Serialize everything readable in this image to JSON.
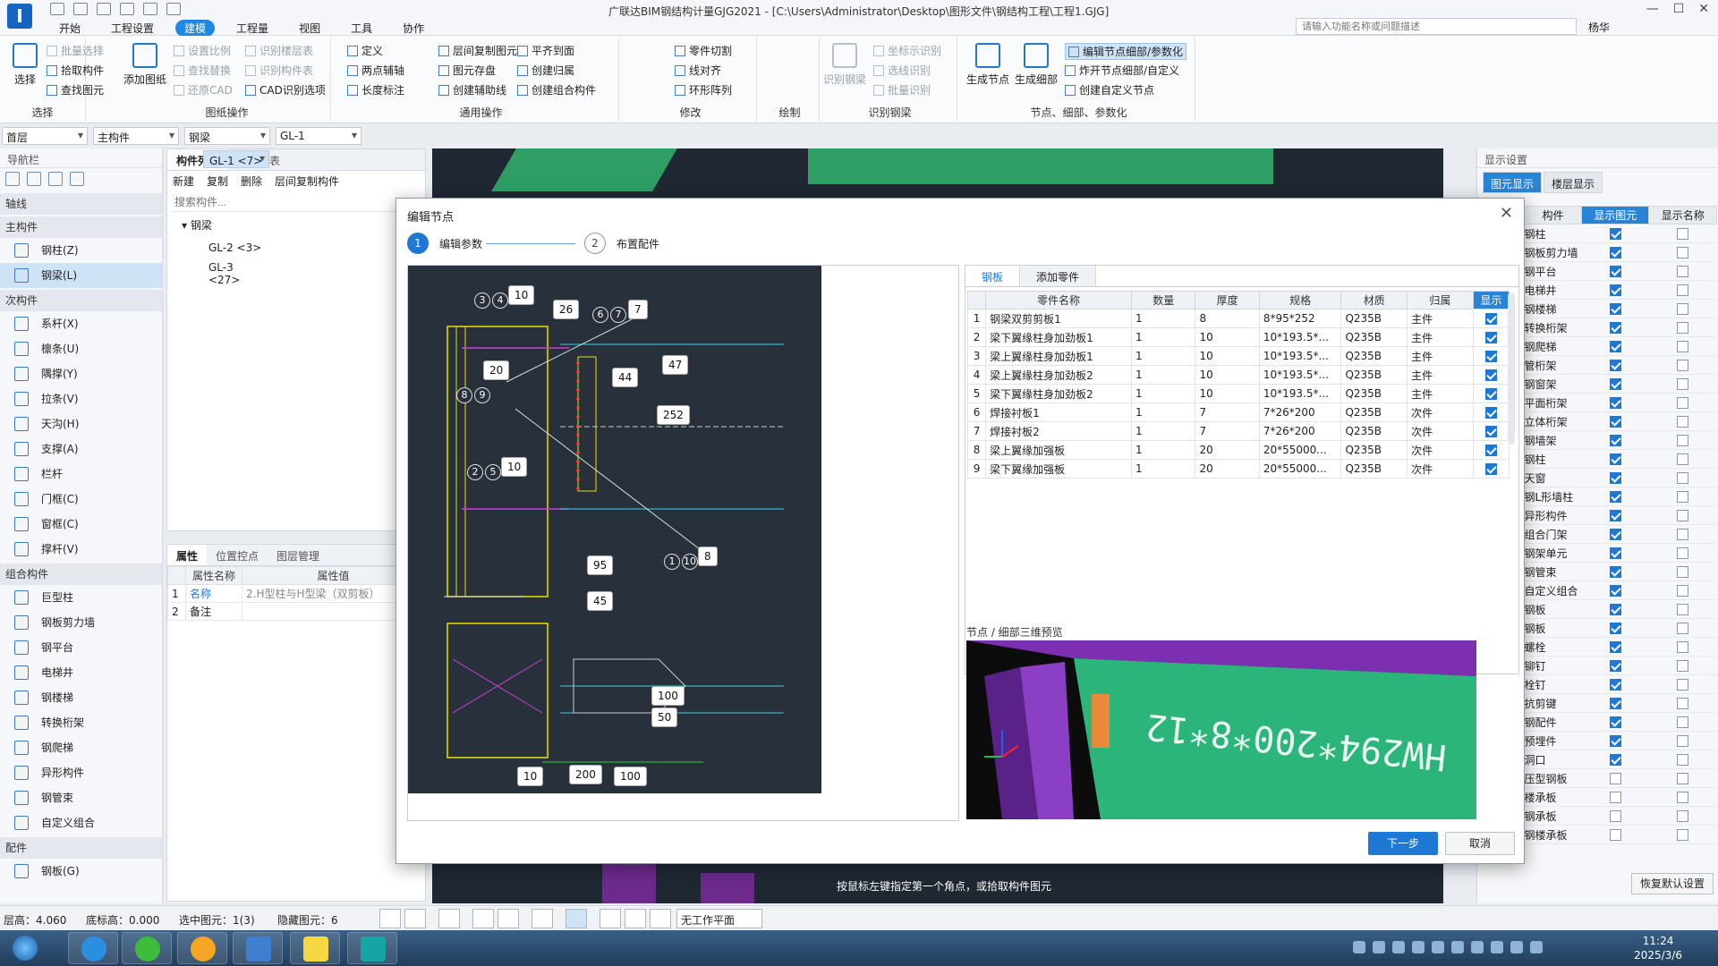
{
  "app": {
    "logo": "I",
    "title": "广联达BIM钢结构计量GJG2021 - [C:\\Users\\Administrator\\Desktop\\图形文件\\钢结构工程\\工程1.GJG]",
    "search_placeholder": "请输入功能名称或问题描述",
    "user": "杨华",
    "menu_tabs": [
      "开始",
      "工程设置",
      "建模",
      "工程量",
      "视图",
      "工具",
      "协作"
    ]
  },
  "ribbon": {
    "select": {
      "big": "选择",
      "items": [
        "批量选择",
        "拾取构件",
        "查找图元"
      ],
      "label": "选择"
    },
    "drawing_ops": {
      "big": "添加图纸",
      "items": [
        "设置比例",
        "查找替换",
        "还原CAD",
        "识别楼层表",
        "识别构件表",
        "CAD识别选项"
      ],
      "label": "图纸操作"
    },
    "common_ops": {
      "items": [
        "定义",
        "两点辅轴",
        "长度标注",
        "层间复制图元",
        "图元存盘",
        "创建辅助线",
        "平齐到面",
        "创建归属",
        "创建组合构件"
      ],
      "label": "通用操作"
    },
    "modify": {
      "items": [
        "零件切割",
        "线对齐",
        "环形阵列"
      ],
      "label": "修改"
    },
    "draw": {
      "label": "绘制"
    },
    "identify_beam": {
      "big": "识别钢梁",
      "items": [
        "坐标示识别",
        "选线识别",
        "批量识别"
      ],
      "label": "识别钢梁"
    },
    "node": {
      "big1": "生成节点",
      "big2": "生成细部",
      "items": [
        "编辑节点细部/参数化",
        "炸开节点细部/自定义",
        "创建自定义节点"
      ],
      "label": "节点、细部、参数化"
    }
  },
  "selectors": [
    "首层",
    "主构件",
    "钢梁",
    "GL-1"
  ],
  "nav": {
    "title": "导航栏",
    "categories": [
      {
        "name": "轴线",
        "items": []
      },
      {
        "name": "主构件",
        "items": [
          "钢柱(Z)",
          "钢梁(L)"
        ]
      },
      {
        "name": "次构件",
        "items": [
          "系杆(X)",
          "檩条(U)",
          "隅撑(Y)",
          "拉条(V)",
          "天沟(H)",
          "支撑(A)",
          "栏杆",
          "门框(C)",
          "窗框(C)",
          "撑杆(V)"
        ]
      },
      {
        "name": "组合构件",
        "items": [
          "巨型柱",
          "钢板剪力墙",
          "钢平台",
          "电梯井",
          "钢楼梯",
          "转换桁架",
          "钢爬梯",
          "异形构件",
          "钢管束",
          "自定义组合"
        ]
      },
      {
        "name": "配件",
        "items": [
          "钢板(G)"
        ]
      }
    ],
    "active": "钢梁(L)"
  },
  "comp": {
    "tabs": [
      "构件列表",
      "图纸列表"
    ],
    "tools": [
      "新建",
      "复制",
      "删除",
      "层间复制构件"
    ],
    "search_placeholder": "搜索构件...",
    "root": "钢梁",
    "items": [
      "GL-1 <7>",
      "GL-2 <3>",
      "GL-3 <27>"
    ]
  },
  "props": {
    "tabs": [
      "属性",
      "位置控点",
      "图层管理"
    ],
    "headers": [
      "属性名称",
      "属性值"
    ],
    "rows": [
      [
        "1",
        "名称",
        "2.H型柱与H型梁（双剪板）"
      ],
      [
        "2",
        "备注",
        ""
      ]
    ]
  },
  "right": {
    "title": "显示设置",
    "tabs": [
      "图元显示",
      "楼层显示"
    ],
    "headers": [
      "构件",
      "显示图元",
      "显示名称"
    ],
    "rows": [
      [
        "钢柱",
        true,
        false
      ],
      [
        "钢板剪力墙",
        true,
        false
      ],
      [
        "钢平台",
        true,
        false
      ],
      [
        "电梯井",
        true,
        false
      ],
      [
        "钢楼梯",
        true,
        false
      ],
      [
        "转换桁架",
        true,
        false
      ],
      [
        "钢爬梯",
        true,
        false
      ],
      [
        "管桁架",
        true,
        false
      ],
      [
        "钢窗架",
        true,
        false
      ],
      [
        "平面桁架",
        true,
        false
      ],
      [
        "立体桁架",
        true,
        false
      ],
      [
        "钢墙架",
        true,
        false
      ],
      [
        "钢柱",
        true,
        false
      ],
      [
        "天窗",
        true,
        false
      ],
      [
        "钢L形墙柱",
        true,
        false
      ],
      [
        "异形构件",
        true,
        false
      ],
      [
        "组合门架",
        true,
        false
      ],
      [
        "钢架单元",
        true,
        false
      ],
      [
        "钢管束",
        true,
        false
      ],
      [
        "自定义组合",
        true,
        false
      ],
      [
        "钢板",
        true,
        false
      ],
      [
        "钢板",
        true,
        false
      ],
      [
        "螺栓",
        true,
        false
      ],
      [
        "铆钉",
        true,
        false
      ],
      [
        "栓钉",
        true,
        false
      ],
      [
        "抗剪键",
        true,
        false
      ],
      [
        "钢配件",
        true,
        false
      ],
      [
        "预埋件",
        true,
        false
      ],
      [
        "洞口",
        true,
        false
      ],
      [
        "压型钢板",
        false,
        false
      ],
      [
        "楼承板",
        false,
        false
      ],
      [
        "钢承板",
        false,
        false
      ],
      [
        "钢楼承板",
        false,
        false
      ]
    ],
    "reset": "恢复默认设置"
  },
  "dialog": {
    "title": "编辑节点",
    "steps": [
      {
        "num": "1",
        "label": "编辑参数"
      },
      {
        "num": "2",
        "label": "布置配件"
      }
    ],
    "dims": [
      "10",
      "26",
      "7",
      "20",
      "44",
      "47",
      "252",
      "10",
      "8",
      "95",
      "45",
      "100",
      "50",
      "10",
      "200",
      "100"
    ],
    "circles": [
      "3",
      "4",
      "6",
      "7",
      "8",
      "9",
      "2",
      "5",
      "1",
      "10"
    ],
    "table_tabs": [
      "钢板",
      "添加零件"
    ],
    "headers": [
      "",
      "零件名称",
      "数量",
      "厚度",
      "规格",
      "材质",
      "归属",
      "显示"
    ],
    "rows": [
      [
        "1",
        "钢梁双剪剪板1",
        "1",
        "8",
        "8*95*252",
        "Q235B",
        "主件",
        true
      ],
      [
        "2",
        "梁下翼缘柱身加劲板1",
        "1",
        "10",
        "10*193.5*...",
        "Q235B",
        "主件",
        true
      ],
      [
        "3",
        "梁上翼缘柱身加劲板1",
        "1",
        "10",
        "10*193.5*...",
        "Q235B",
        "主件",
        true
      ],
      [
        "4",
        "梁上翼缘柱身加劲板2",
        "1",
        "10",
        "10*193.5*...",
        "Q235B",
        "主件",
        true
      ],
      [
        "5",
        "梁下翼缘柱身加劲板2",
        "1",
        "10",
        "10*193.5*...",
        "Q235B",
        "主件",
        true
      ],
      [
        "6",
        "焊接衬板1",
        "1",
        "7",
        "7*26*200",
        "Q235B",
        "次件",
        true
      ],
      [
        "7",
        "焊接衬板2",
        "1",
        "7",
        "7*26*200",
        "Q235B",
        "次件",
        true
      ],
      [
        "8",
        "梁上翼缘加强板",
        "1",
        "20",
        "20*55000...",
        "Q235B",
        "次件",
        true
      ],
      [
        "9",
        "梁下翼缘加强板",
        "1",
        "20",
        "20*55000...",
        "Q235B",
        "次件",
        true
      ]
    ],
    "preview_label": "节点 / 细部三维预览",
    "preview_text": "HW294*200*8*12",
    "next": "下一步",
    "cancel": "取消"
  },
  "canvas_hint": "按鼠标左键指定第一个角点，或拾取构件图元",
  "status": {
    "floor_height": "层高：4.060",
    "bottom_elev": "底标高：0.000",
    "selected": "选中图元：1(3)",
    "hidden": "隐藏图元：6",
    "plane": "无工作平面"
  },
  "taskbar": {
    "time": "11:24",
    "date": "2025/3/6"
  }
}
